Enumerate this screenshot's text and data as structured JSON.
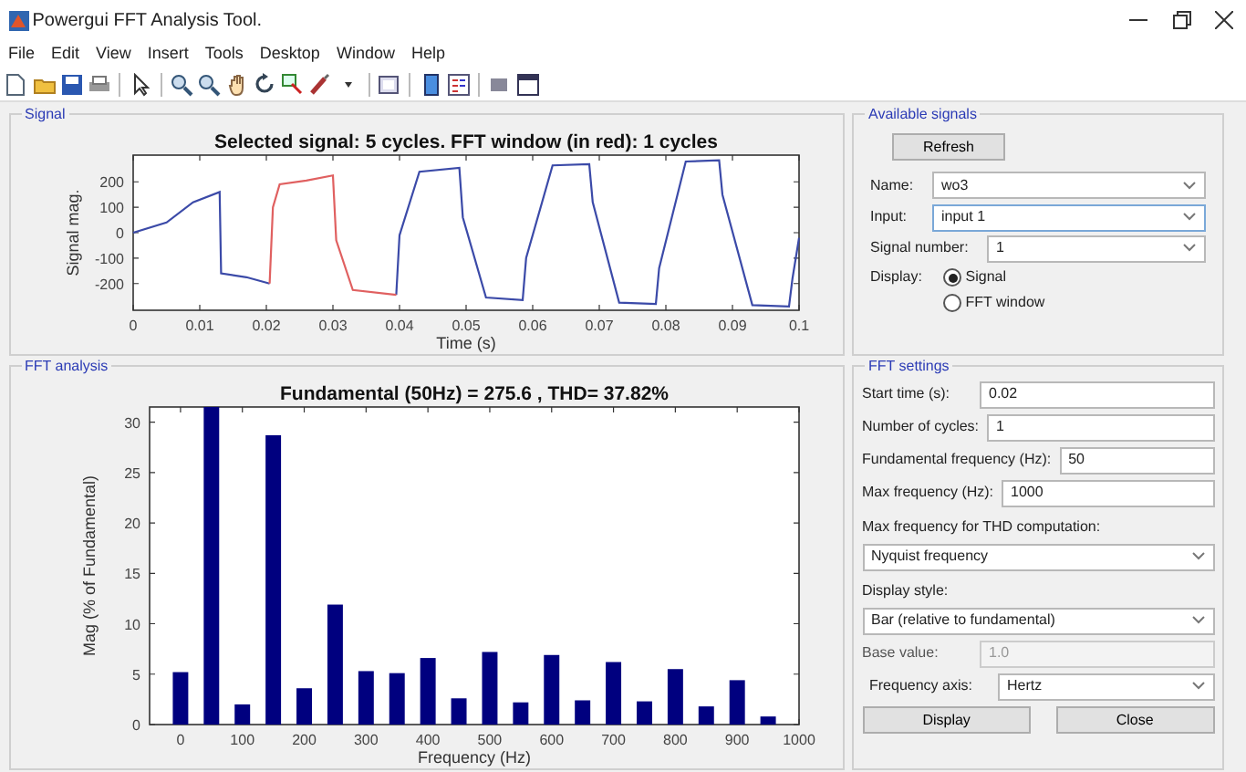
{
  "window": {
    "title": "Powergui FFT Analysis Tool."
  },
  "menu": [
    "File",
    "Edit",
    "View",
    "Insert",
    "Tools",
    "Desktop",
    "Window",
    "Help"
  ],
  "signal_panel": {
    "title": "Signal",
    "chart_data": {
      "type": "line",
      "title": "Selected signal: 5 cycles. FFT window (in red): 1 cycles",
      "xlabel": "Time (s)",
      "ylabel": "Signal mag.",
      "x": [
        0,
        0.005,
        0.009,
        0.013,
        0.0132,
        0.017,
        0.0205,
        0.021,
        0.022,
        0.026,
        0.03,
        0.0305,
        0.033,
        0.0395,
        0.04,
        0.043,
        0.049,
        0.0495,
        0.053,
        0.0585,
        0.059,
        0.063,
        0.0685,
        0.069,
        0.073,
        0.0785,
        0.079,
        0.083,
        0.088,
        0.0885,
        0.093,
        0.0985,
        0.099,
        0.1
      ],
      "series": [
        {
          "color": "#3b4aa8",
          "values": [
            0,
            40,
            120,
            160,
            -160,
            -175,
            -200,
            null,
            null,
            null,
            null,
            null,
            null,
            -245,
            -10,
            240,
            255,
            60,
            -255,
            -265,
            -100,
            265,
            270,
            120,
            -275,
            -280,
            -140,
            280,
            285,
            150,
            -285,
            -290,
            -180,
            -20
          ]
        },
        {
          "color": "#e06060",
          "values": [
            null,
            null,
            null,
            null,
            null,
            null,
            -200,
            100,
            190,
            205,
            225,
            -30,
            -225,
            -245,
            null,
            null,
            null,
            null,
            null,
            null,
            null,
            null,
            null,
            null,
            null,
            null,
            null,
            null,
            null,
            null,
            null,
            null,
            null,
            null
          ]
        }
      ],
      "xlim": [
        0,
        0.1
      ],
      "ylim": [
        -305,
        305
      ],
      "xticks": [
        0,
        0.01,
        0.02,
        0.03,
        0.04,
        0.05,
        0.06,
        0.07,
        0.08,
        0.09,
        0.1
      ],
      "yticks": [
        -200,
        -100,
        0,
        100,
        200
      ]
    }
  },
  "fft_panel": {
    "title": "FFT analysis",
    "chart_data": {
      "type": "bar",
      "title": "Fundamental (50Hz) = 275.6 , THD= 37.82%",
      "xlabel": "Frequency (Hz)",
      "ylabel": "Mag (% of Fundamental)",
      "x": [
        0,
        50,
        100,
        150,
        200,
        250,
        300,
        350,
        400,
        450,
        500,
        550,
        600,
        650,
        700,
        750,
        800,
        850,
        900,
        950
      ],
      "values": [
        5.2,
        31.5,
        2.0,
        28.7,
        3.6,
        11.9,
        5.3,
        5.1,
        6.6,
        2.6,
        7.2,
        2.2,
        6.9,
        2.4,
        6.2,
        2.3,
        5.5,
        1.8,
        4.4,
        0.8
      ],
      "xlim": [
        -50,
        1000
      ],
      "ylim": [
        0,
        31.5
      ],
      "xticks": [
        0,
        100,
        200,
        300,
        400,
        500,
        600,
        700,
        800,
        900,
        1000
      ],
      "yticks": [
        0,
        5,
        10,
        15,
        20,
        25,
        30
      ]
    }
  },
  "available_signals": {
    "title": "Available signals",
    "refresh_button": "Refresh",
    "fields": [
      {
        "label": "Name:",
        "value": "wo3",
        "focused": false
      },
      {
        "label": "Input:",
        "value": "input 1",
        "focused": true
      },
      {
        "label": "Signal number:",
        "value": "1",
        "focused": false
      }
    ],
    "display": {
      "label": "Display:",
      "options": [
        {
          "label": "Signal",
          "selected": true
        },
        {
          "label": "FFT window",
          "selected": false
        }
      ]
    }
  },
  "fft_settings": {
    "title": "FFT settings",
    "rows": [
      {
        "kind": "input",
        "label": "Start time (s):",
        "value": "0.02",
        "disabled": false
      },
      {
        "kind": "input",
        "label": "Number of cycles:",
        "value": "1",
        "disabled": false
      },
      {
        "kind": "input",
        "label": "Fundamental frequency (Hz):",
        "value": "50",
        "disabled": false
      },
      {
        "kind": "input",
        "label": "Max frequency (Hz):",
        "value": "1000",
        "disabled": false
      },
      {
        "kind": "caption",
        "label": "Max frequency for THD computation:"
      },
      {
        "kind": "select",
        "value": "Nyquist frequency",
        "disabled": false
      },
      {
        "kind": "caption",
        "label": "Display style:"
      },
      {
        "kind": "select",
        "value": "Bar (relative to fundamental)",
        "disabled": false
      },
      {
        "kind": "input",
        "label": "Base value:",
        "value": "1.0",
        "disabled": true
      },
      {
        "kind": "labeled-select",
        "label": "Frequency axis:",
        "value": "Hertz",
        "disabled": false
      }
    ],
    "buttons": [
      "Display",
      "Close"
    ]
  }
}
